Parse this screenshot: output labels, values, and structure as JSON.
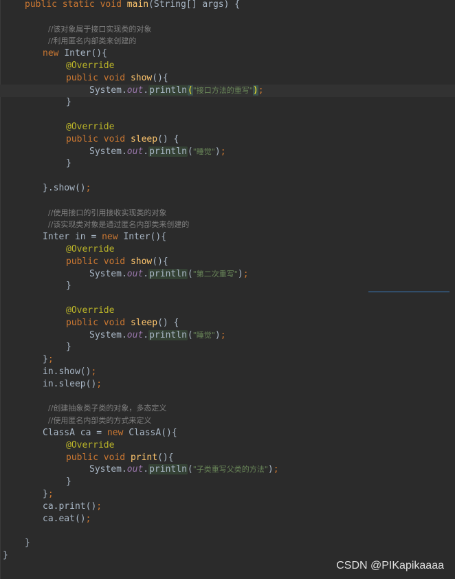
{
  "code": {
    "lines": [
      {
        "indent": 0,
        "tokens": [
          {
            "t": "kw",
            "v": "public "
          },
          {
            "t": "kw",
            "v": "static "
          },
          {
            "t": "kw",
            "v": "void "
          },
          {
            "t": "fn",
            "v": "main"
          },
          {
            "t": "plain",
            "v": "(String[] args) {"
          }
        ]
      },
      {
        "indent": 0,
        "tokens": []
      },
      {
        "indent": 2,
        "tokens": [
          {
            "t": "cmt",
            "v": "//该对象属于接口实现类的对象"
          }
        ]
      },
      {
        "indent": 2,
        "tokens": [
          {
            "t": "cmt",
            "v": "//利用匿名内部类来创建的"
          }
        ]
      },
      {
        "indent": 2,
        "tokens": [
          {
            "t": "kw",
            "v": "new "
          },
          {
            "t": "plain",
            "v": "Inter(){"
          }
        ]
      },
      {
        "indent": 3,
        "tokens": [
          {
            "t": "ann",
            "v": "@Override"
          }
        ]
      },
      {
        "indent": 3,
        "tokens": [
          {
            "t": "kw",
            "v": "public "
          },
          {
            "t": "kw",
            "v": "void "
          },
          {
            "t": "fn",
            "v": "show"
          },
          {
            "t": "plain",
            "v": "(){"
          }
        ]
      },
      {
        "indent": 4,
        "current": true,
        "tokens": [
          {
            "t": "plain",
            "v": "System."
          },
          {
            "t": "field",
            "v": "out"
          },
          {
            "t": "plain",
            "v": "."
          },
          {
            "t": "println",
            "v": "println"
          },
          {
            "t": "parenhl",
            "v": "("
          },
          {
            "t": "strcn",
            "v": "\"接口方法的重写\""
          },
          {
            "t": "parenhl",
            "v": ")"
          },
          {
            "t": "kw",
            "v": ";"
          }
        ]
      },
      {
        "indent": 3,
        "tokens": [
          {
            "t": "plain",
            "v": "}"
          }
        ]
      },
      {
        "indent": 0,
        "tokens": []
      },
      {
        "indent": 3,
        "tokens": [
          {
            "t": "ann",
            "v": "@Override"
          }
        ]
      },
      {
        "indent": 3,
        "tokens": [
          {
            "t": "kw",
            "v": "public "
          },
          {
            "t": "kw",
            "v": "void "
          },
          {
            "t": "fn",
            "v": "sleep"
          },
          {
            "t": "plain",
            "v": "() {"
          }
        ]
      },
      {
        "indent": 4,
        "tokens": [
          {
            "t": "plain",
            "v": "System."
          },
          {
            "t": "field",
            "v": "out"
          },
          {
            "t": "plain",
            "v": "."
          },
          {
            "t": "println",
            "v": "println"
          },
          {
            "t": "plain",
            "v": "("
          },
          {
            "t": "strcn",
            "v": "\"睡觉\""
          },
          {
            "t": "plain",
            "v": ")"
          },
          {
            "t": "kw",
            "v": ";"
          }
        ]
      },
      {
        "indent": 3,
        "tokens": [
          {
            "t": "plain",
            "v": "}"
          }
        ]
      },
      {
        "indent": 0,
        "tokens": []
      },
      {
        "indent": 2,
        "tokens": [
          {
            "t": "plain",
            "v": "}.show()"
          },
          {
            "t": "kw",
            "v": ";"
          }
        ]
      },
      {
        "indent": 0,
        "tokens": []
      },
      {
        "indent": 2,
        "tokens": [
          {
            "t": "cmt",
            "v": "//使用接口的引用接收实现类的对象"
          }
        ]
      },
      {
        "indent": 2,
        "tokens": [
          {
            "t": "cmt",
            "v": "//该实现类对象是通过匿名内部类来创建的"
          }
        ]
      },
      {
        "indent": 2,
        "tokens": [
          {
            "t": "plain",
            "v": "Inter in = "
          },
          {
            "t": "kw",
            "v": "new "
          },
          {
            "t": "plain",
            "v": "Inter(){"
          }
        ]
      },
      {
        "indent": 3,
        "tokens": [
          {
            "t": "ann",
            "v": "@Override"
          }
        ]
      },
      {
        "indent": 3,
        "tokens": [
          {
            "t": "kw",
            "v": "public "
          },
          {
            "t": "kw",
            "v": "void "
          },
          {
            "t": "fn",
            "v": "show"
          },
          {
            "t": "plain",
            "v": "(){"
          }
        ]
      },
      {
        "indent": 4,
        "tokens": [
          {
            "t": "plain",
            "v": "System."
          },
          {
            "t": "field",
            "v": "out"
          },
          {
            "t": "plain",
            "v": "."
          },
          {
            "t": "println",
            "v": "println"
          },
          {
            "t": "plain",
            "v": "("
          },
          {
            "t": "strcn",
            "v": "\"第二次重写\""
          },
          {
            "t": "plain",
            "v": ")"
          },
          {
            "t": "kw",
            "v": ";"
          }
        ]
      },
      {
        "indent": 3,
        "tokens": [
          {
            "t": "plain",
            "v": "}"
          }
        ]
      },
      {
        "indent": 0,
        "tokens": []
      },
      {
        "indent": 3,
        "tokens": [
          {
            "t": "ann",
            "v": "@Override"
          }
        ]
      },
      {
        "indent": 3,
        "tokens": [
          {
            "t": "kw",
            "v": "public "
          },
          {
            "t": "kw",
            "v": "void "
          },
          {
            "t": "fn",
            "v": "sleep"
          },
          {
            "t": "plain",
            "v": "() {"
          }
        ]
      },
      {
        "indent": 4,
        "tokens": [
          {
            "t": "plain",
            "v": "System."
          },
          {
            "t": "field",
            "v": "out"
          },
          {
            "t": "plain",
            "v": "."
          },
          {
            "t": "println",
            "v": "println"
          },
          {
            "t": "plain",
            "v": "("
          },
          {
            "t": "strcn",
            "v": "\"睡觉\""
          },
          {
            "t": "plain",
            "v": ")"
          },
          {
            "t": "kw",
            "v": ";"
          }
        ]
      },
      {
        "indent": 3,
        "tokens": [
          {
            "t": "plain",
            "v": "}"
          }
        ]
      },
      {
        "indent": 2,
        "tokens": [
          {
            "t": "plain",
            "v": "}"
          },
          {
            "t": "kw",
            "v": ";"
          }
        ]
      },
      {
        "indent": 2,
        "tokens": [
          {
            "t": "plain",
            "v": "in.show()"
          },
          {
            "t": "kw",
            "v": ";"
          }
        ]
      },
      {
        "indent": 2,
        "tokens": [
          {
            "t": "plain",
            "v": "in.sleep()"
          },
          {
            "t": "kw",
            "v": ";"
          }
        ]
      },
      {
        "indent": 0,
        "tokens": []
      },
      {
        "indent": 2,
        "tokens": [
          {
            "t": "cmt",
            "v": "//创建抽象类子类的对象，多态定义"
          }
        ]
      },
      {
        "indent": 2,
        "tokens": [
          {
            "t": "cmt",
            "v": "//使用匿名内部类的方式来定义"
          }
        ]
      },
      {
        "indent": 2,
        "tokens": [
          {
            "t": "plain",
            "v": "ClassA ca = "
          },
          {
            "t": "kw",
            "v": "new "
          },
          {
            "t": "plain",
            "v": "ClassA(){"
          }
        ]
      },
      {
        "indent": 3,
        "tokens": [
          {
            "t": "ann",
            "v": "@Override"
          }
        ]
      },
      {
        "indent": 3,
        "tokens": [
          {
            "t": "kw",
            "v": "public "
          },
          {
            "t": "kw",
            "v": "void "
          },
          {
            "t": "fn",
            "v": "print"
          },
          {
            "t": "plain",
            "v": "(){"
          }
        ]
      },
      {
        "indent": 4,
        "tokens": [
          {
            "t": "plain",
            "v": "System."
          },
          {
            "t": "field",
            "v": "out"
          },
          {
            "t": "plain",
            "v": "."
          },
          {
            "t": "println",
            "v": "println"
          },
          {
            "t": "plain",
            "v": "("
          },
          {
            "t": "strcn",
            "v": "\"子类重写父类的方法\""
          },
          {
            "t": "plain",
            "v": ")"
          },
          {
            "t": "kw",
            "v": ";"
          }
        ]
      },
      {
        "indent": 3,
        "tokens": [
          {
            "t": "plain",
            "v": "}"
          }
        ]
      },
      {
        "indent": 2,
        "tokens": [
          {
            "t": "plain",
            "v": "}"
          },
          {
            "t": "kw",
            "v": ";"
          }
        ]
      },
      {
        "indent": 2,
        "tokens": [
          {
            "t": "plain",
            "v": "ca.print()"
          },
          {
            "t": "kw",
            "v": ";"
          }
        ]
      },
      {
        "indent": 2,
        "tokens": [
          {
            "t": "plain",
            "v": "ca.eat()"
          },
          {
            "t": "kw",
            "v": ";"
          }
        ]
      },
      {
        "indent": 0,
        "tokens": []
      },
      {
        "indent": 1,
        "tokens": [
          {
            "t": "plain",
            "v": "}"
          }
        ]
      },
      {
        "indent": 0,
        "tokens": [
          {
            "t": "plain",
            "v": "}"
          }
        ]
      }
    ]
  },
  "watermark": {
    "text": "CSDN @PIKapikaaaa"
  }
}
